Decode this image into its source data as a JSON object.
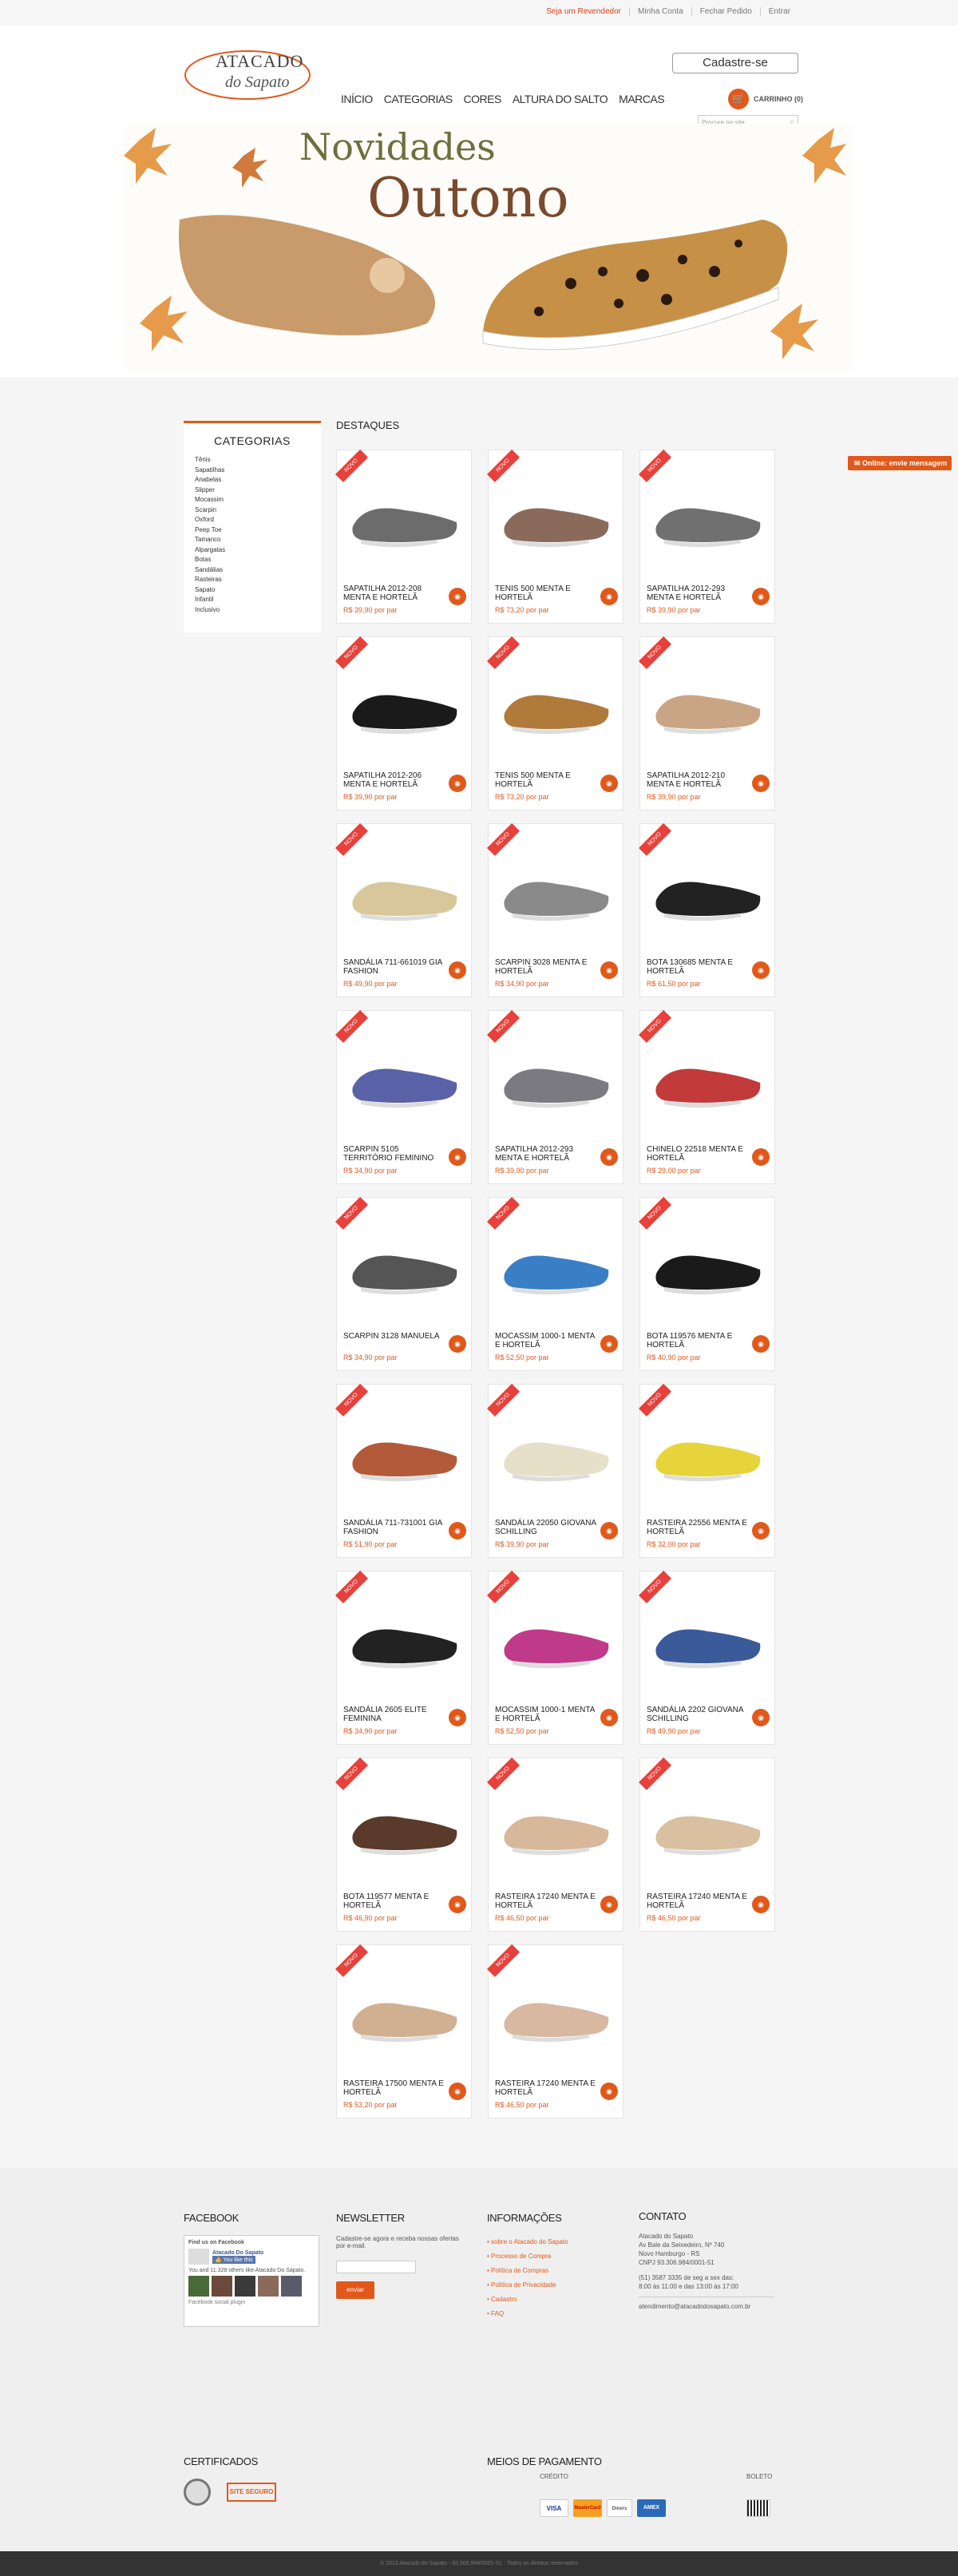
{
  "topbar": {
    "links": [
      "Seja um Revendedor",
      "Minha Conta",
      "Fechar Pedido",
      "Entrar"
    ]
  },
  "header": {
    "logo_line1": "ATACADO",
    "logo_line2": "do Sapato",
    "nav": [
      "INÍCIO",
      "CATEGORIAS",
      "CORES",
      "ALTURA DO SALTO",
      "MARCAS"
    ],
    "signup_label": "Cadastre-se",
    "cart_label": "CARRINHO (0)",
    "search_placeholder": "Procure no site..."
  },
  "banner": {
    "line1": "Novidades",
    "line2": "Outono"
  },
  "sidebar": {
    "title": "CATEGORIAS",
    "items": [
      "Tênis",
      "Sapatilhas",
      "Anabelas",
      "Slipper",
      "Mocassim",
      "Scarpin",
      "Oxford",
      "Peep Toe",
      "Tamanco",
      "Alpargatas",
      "Botas",
      "Sandálias",
      "Rasteiras",
      "Sapato",
      "Infantil",
      "Inclusivo"
    ]
  },
  "products_heading": "DESTAQUES",
  "badge": "NOVO",
  "products": [
    {
      "name": "SAPATILHA 2012-208 MENTA E HORTELÃ",
      "price": "R$ 39,90 por par",
      "color": "#6c6c6c"
    },
    {
      "name": "TENIS 500 MENTA E HORTELÃ",
      "price": "R$ 73,20 por par",
      "color": "#8a6a5a"
    },
    {
      "name": "SAPATILHA 2012-293 MENTA E HORTELÃ",
      "price": "R$ 39,90 por par",
      "color": "#707070"
    },
    {
      "name": "SAPATILHA 2012-206 MENTA E HORTELÃ",
      "price": "R$ 39,90 por par",
      "color": "#1a1a1a"
    },
    {
      "name": "TENIS 500 MENTA E HORTELÃ",
      "price": "R$ 73,20 por par",
      "color": "#b07a3a"
    },
    {
      "name": "SAPATILHA 2012-210 MENTA E HORTELÃ",
      "price": "R$ 39,90 por par",
      "color": "#c9a585"
    },
    {
      "name": "SANDÁLIA 711-661019 GIA FASHION",
      "price": "R$ 49,90 por par",
      "color": "#d8c79a"
    },
    {
      "name": "SCARPIN 3028 MENTA E HORTELÃ",
      "price": "R$ 34,90 por par",
      "color": "#8a8a8a"
    },
    {
      "name": "BOTA 130685 MENTA E HORTELÃ",
      "price": "R$ 61,50 por par",
      "color": "#222222"
    },
    {
      "name": "SCARPIN 5105 TERRITÓRIO FEMININO",
      "price": "R$ 34,90 por par",
      "color": "#5a62a8"
    },
    {
      "name": "SAPATILHA 2012-293 MENTA E HORTELÃ",
      "price": "R$ 39,90 por par",
      "color": "#7a7a80"
    },
    {
      "name": "CHINELO 22518 MENTA E HORTELÃ",
      "price": "R$ 29,00 por par",
      "color": "#c23a3a"
    },
    {
      "name": "SCARPIN 3128 MANUELA",
      "price": "R$ 34,90 por par",
      "color": "#555555"
    },
    {
      "name": "MOCASSIM 1000-1 MENTA E HORTELÃ",
      "price": "R$ 52,50 por par",
      "color": "#3a7fc6"
    },
    {
      "name": "BOTA 119576 MENTA E HORTELÃ",
      "price": "R$ 40,90 por par",
      "color": "#1a1a1a"
    },
    {
      "name": "SANDÁLIA 711-731001 GIA FASHION",
      "price": "R$ 51,90 por par",
      "color": "#b25a3a"
    },
    {
      "name": "SANDÁLIA 22050 GIOVANA SCHILLING",
      "price": "R$ 39,90 por par",
      "color": "#e6e0c8"
    },
    {
      "name": "RASTEIRA 22556 MENTA E HORTELÃ",
      "price": "R$ 32,00 por par",
      "color": "#e6d43a"
    },
    {
      "name": "SANDÁLIA 2605 ELITE FEMININA",
      "price": "R$ 34,90 por par",
      "color": "#222222"
    },
    {
      "name": "MOCASSIM 1000-1 MENTA E HORTELÃ",
      "price": "R$ 52,50 por par",
      "color": "#c03a8a"
    },
    {
      "name": "SANDÁLIA 2202 GIOVANA SCHILLING",
      "price": "R$ 49,90 por par",
      "color": "#3a5a9a"
    },
    {
      "name": "BOTA 119577 MENTA E HORTELÃ",
      "price": "R$ 46,90 por par",
      "color": "#5a3a2a"
    },
    {
      "name": "RASTEIRA 17240 MENTA E HORTELÃ",
      "price": "R$ 46,50 por par",
      "color": "#d8b89a"
    },
    {
      "name": "RASTEIRA 17240 MENTA E HORTELÃ",
      "price": "R$ 46,50 por par",
      "color": "#d8c0a0"
    },
    {
      "name": "RASTEIRA 17500 MENTA E HORTELÃ",
      "price": "R$ 53,20 por par",
      "color": "#d0b090"
    },
    {
      "name": "RASTEIRA 17240 MENTA E HORTELÃ",
      "price": "R$ 46,50 por par",
      "color": "#d8b8a0"
    }
  ],
  "chat_label": "Online: envie mensagem",
  "footer": {
    "facebook": {
      "title": "FACEBOOK",
      "find_us": "Find us on Facebook",
      "page_name": "Atacado Do Sapato",
      "like": "You like this",
      "fans": "You and 11.328 others like Atacado Do Sapato.",
      "plugin": "Facebook social plugin"
    },
    "newsletter": {
      "title": "NEWSLETTER",
      "text": "Cadastre-se agora e receba nossas ofertas por e-mail.",
      "button": "enviar"
    },
    "info": {
      "title": "INFORMAÇÕES",
      "items": [
        "sobre o Atacado do Sapato",
        "Processo de Compra",
        "Política de Compras",
        "Política de Privacidade",
        "Cadastro",
        "FAQ"
      ]
    },
    "contact": {
      "title": "CONTATO",
      "lines": [
        "Atacado do Sapato",
        "Av Bale da Seixedeiro, Nº 740",
        "Novo Hamburgo - RS",
        "CNPJ 93.306.984/0001-51",
        "",
        "(51) 3587 3335 de seg a sex das:",
        "8:00 às 11:00 e das 13:00 às 17:00",
        "",
        "atendimento@atacadodosapato.com.br"
      ]
    },
    "certs_title": "CERTIFICADOS",
    "payment_title": "MEIOS DE PAGAMENTO",
    "credit_label": "CRÉDITO",
    "boleto_label": "BOLETO",
    "cards": [
      "VISA",
      "MasterCard",
      "Diners",
      "AMEX"
    ],
    "seal_label": "SITE SEGURO"
  },
  "copyright": "© 2013 Atacado do Sapato - 93.306.984/0001-51 - Todos os direitos reservados"
}
